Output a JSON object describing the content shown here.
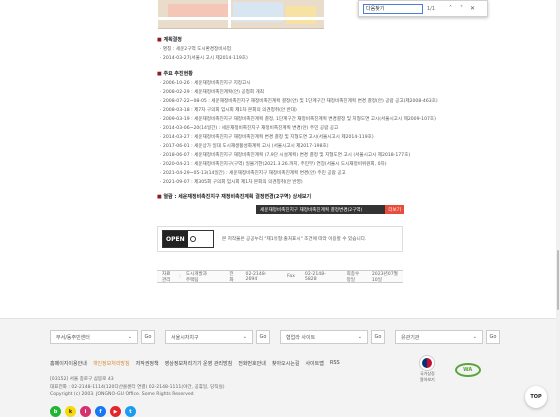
{
  "find_bar": {
    "query": "다음찾기",
    "count": "1/1",
    "prev": "˄",
    "next": "˅",
    "close": "✕"
  },
  "section1": {
    "title": "계획결정",
    "bullet": "■",
    "items": [
      "· 명칭 : 세운2구역 도시환경정비사업",
      "· 2014-03-27(서울시 고시 제2014-119호)"
    ]
  },
  "section2": {
    "title": "주요 추진현황",
    "bullet": "■",
    "items": [
      "· 2006-10-26 : 세운재정비촉진지구 지정고시",
      "· 2008-02-29 : 세운재정비촉진계획(안) 공청회 개최",
      "· 2008-07-22~08-05 : 세운재정비촉진지구 재정비촉진계획 결정(안) 및 1단계구간 재정비촉진계획 변경 결정(안) 공람 공고(제2008-463호)",
      "· 2008-03-18 : 제7차 구의회 임시회 제1차 본회의 의견청취(안 반대)",
      "· 2009-03-19 : 세운재정비촉진지구 재정비촉진계획 결정, 1단계구간 재정비촉진계획 변경결정 및 지형도면 고시(서울시고시 제2009-107호)",
      "· 2014-03-06~20(14일간) : 세운재정비촉진지구 재정비촉진계획 변경(안) 주민 공람 공고",
      "· 2014-03-27 : 세운재정비촉진지구 재정비촉진계획 변경 결정 및 지형도면 고시(서울시고시 제2014-119호)",
      "· 2017-06-01 : 세운상가 일대 도시재생활성화계획 고시 (서울시고시 제2017-198호)",
      "· 2018-06-07 : 세운재정비촉진지구 재정비촉진계획 (7,9단 시설계획) 변경 결정 및 지형도면 고시 (서울시고시 제2018-177호)",
      "· 2020-04-21 : 세운재정비촉진지구(구역) 일몰기한(2021.3.26.까지, 주민부) 연장(서울시 도시재정비위원회, 0차)",
      "· 2021-04-29~05-13(14일간) : 세운재정비촉진지구 재정비촉진계획 변경(안) 주민 공람 공고",
      "· 2021-09-07 : 제305회 구의회 임시회 제1차 본회의 의견청취(안 반영)"
    ]
  },
  "section3": {
    "title": "열람 : 세운재정비촉진지구 재정비촉진계획 결정변경(2구역) 상세보기",
    "bullet": "■"
  },
  "detail_bar": {
    "label": "세운재정비촉진지구 재정비촉진계획 결정변경(2구역)",
    "tag": "더보기"
  },
  "open_license": {
    "logo": "OPEN",
    "logo_sub": "공공누리",
    "text": "본 저작물은 공공누리 \"제1유형:출처표시\" 조건에 따라 이용할 수 있습니다."
  },
  "info": {
    "dept_label": "자료관리",
    "dept": "도시개발과 주택팀",
    "tel_label": "전화",
    "tel": "02-2148-2694",
    "fax_label": "Fax",
    "fax": "02-2148-5828",
    "date_label": "최종수정일",
    "date": "2023년07월10일"
  },
  "footer": {
    "selects": [
      {
        "value": "부서/동주민센터",
        "go": "Go"
      },
      {
        "value": "서울시자치구",
        "go": "Go"
      },
      {
        "value": "협업라 사이트",
        "go": "Go"
      },
      {
        "value": "유관기관",
        "go": "Go"
      }
    ],
    "links": [
      "홈페이지이용안내",
      "개인정보처리방침",
      "저작권정책",
      "영상정보처리기기 운영 관리방침",
      "전화번호안내",
      "찾아오시는길",
      "사이트맵",
      "RSS"
    ],
    "address1": "[03152] 서울 종로구 삼봉로 43",
    "address2": "대표전화 : 02-2148-1114(120다산콜센터 연결) 02-2148-1111(야간, 공휴일, 당직실)",
    "copyright": "Copyright (c) 2003. JONGNO-GU Office. Some Rights Reserved",
    "marks": [
      {
        "label": "국가상징\n알아보기"
      },
      {
        "label": "WA"
      }
    ],
    "social": [
      {
        "name": "naver-blog",
        "glyph": "b",
        "color": "#20b532"
      },
      {
        "name": "kakaotalk",
        "glyph": "k",
        "color": "#f5d90a"
      },
      {
        "name": "instagram",
        "glyph": "i",
        "color": "#d6316f"
      },
      {
        "name": "facebook",
        "glyph": "f",
        "color": "#1877f2"
      },
      {
        "name": "youtube",
        "glyph": "▶",
        "color": "#e3242b"
      },
      {
        "name": "twitter",
        "glyph": "t",
        "color": "#1d9bf0"
      }
    ],
    "top_label": "TOP"
  }
}
